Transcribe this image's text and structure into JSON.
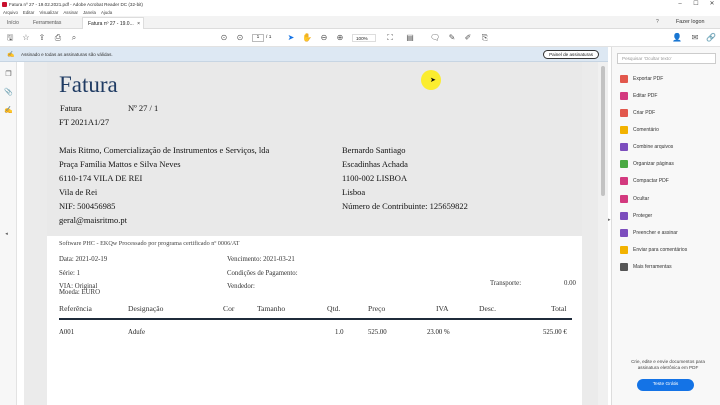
{
  "window": {
    "title": "Fatura nº 27 - 19.02.2021.pdf - Adobe Acrobat Reader DC (32-bit)",
    "controls": [
      "–",
      "☐",
      "✕"
    ]
  },
  "menu": [
    "Arquivo",
    "Editar",
    "Visualizar",
    "Assinar",
    "Janela",
    "Ajuda"
  ],
  "tabs": {
    "home": "Início",
    "tools": "Ferramentas",
    "doc": "Fatura nº 27 - 19.0...",
    "close": "×",
    "login": "Fazer logon"
  },
  "toolbar": {
    "page_current": "1",
    "page_sep": "/",
    "page_total": "1",
    "zoom": "100%"
  },
  "sigbar": {
    "text": "Assinado e todas as assinaturas são válidas.",
    "button": "Painel de assinaturas"
  },
  "invoice": {
    "title": "Fatura",
    "doc_label": "Fatura",
    "doc_no_label": "Nº",
    "doc_no": "27",
    "slash": "/",
    "copy": "1",
    "ref": "FT 2021A1/27",
    "company": [
      "Mais Ritmo, Comercialização de Instrumentos e Serviços, lda",
      "Praça Família Mattos e Silva Neves",
      "6110-174 VILA DE REI",
      "Vila de Rei",
      "NIF: 500456985",
      " geral@maisritmo.pt"
    ],
    "client": [
      "Bernardo Santiago",
      " Escadinhas Achada",
      " 1100-002 LISBOA",
      "Lisboa",
      "Número de Contribuinte: 125659822"
    ],
    "software": "Software PHC - EKQw Processado por programa certificado nº 0006/AT",
    "date_label": "Data:",
    "date": "2021-02-19",
    "due_label": "Vencimento:",
    "due": "2021-03-21",
    "series_label": "Série:",
    "series": "1",
    "payment_label": "Condições de Pagamento:",
    "via_label": "VIA:",
    "via": "Original",
    "seller_label": "Vendedor:",
    "transport_label": "Transporte:",
    "transport": "0.00",
    "currency_label": "Moeda:",
    "currency": "EURO",
    "columns": [
      "Referência",
      "Designação",
      "Cor",
      "Tamanho",
      "Qtd.",
      "Preço",
      "IVA",
      "Desc.",
      "Total"
    ],
    "row": [
      "A001",
      "Adufe",
      "",
      "",
      "1.0",
      "525.00",
      "23.00 %",
      "",
      "525.00 €"
    ]
  },
  "right_panel": {
    "search_placeholder": "Pesquisar 'Ocultar texto'",
    "items": [
      {
        "label": "Exportar PDF",
        "color": "#e2574c"
      },
      {
        "label": "Editar PDF",
        "color": "#d3397f"
      },
      {
        "label": "Criar PDF",
        "color": "#e2574c"
      },
      {
        "label": "Comentário",
        "color": "#f2b200"
      },
      {
        "label": "Combine arquivos",
        "color": "#7c4dbd"
      },
      {
        "label": "Organizar páginas",
        "color": "#49a942"
      },
      {
        "label": "Compactar PDF",
        "color": "#d3397f"
      },
      {
        "label": "Ocultar",
        "color": "#d3397f"
      },
      {
        "label": "Proteger",
        "color": "#7c4dbd"
      },
      {
        "label": "Preencher e assinar",
        "color": "#7c4dbd"
      },
      {
        "label": "Enviar para comentários",
        "color": "#f2b200"
      },
      {
        "label": "Mais ferramentas",
        "color": "#555555"
      }
    ],
    "promo": "Crie, edite e envie documentos para assinatura eletrônica em PDF",
    "trial_button": "Teste Grátis"
  }
}
